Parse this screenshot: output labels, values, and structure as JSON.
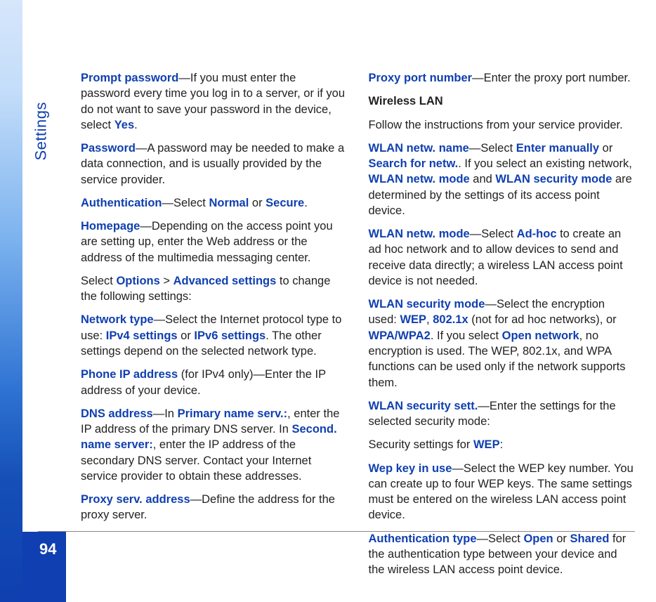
{
  "layout": {
    "section_label": "Settings",
    "page_number": "94"
  },
  "left": {
    "p1_hl_promptpw": "Prompt password",
    "p1_a": "—If you must enter the password every time you log in to a server, or if you do not want to save your password in the device, select ",
    "p1_hl_yes": "Yes",
    "p1_b": ".",
    "p2_hl_password": "Password",
    "p2_a": "—A password may be needed to make a data connection, and is usually provided by the service provider.",
    "p3_hl_auth": "Authentication",
    "p3_a": "—Select ",
    "p3_hl_normal": "Normal",
    "p3_b": " or ",
    "p3_hl_secure": "Secure",
    "p3_c": ".",
    "p4_hl_homepage": "Homepage",
    "p4_a": "—Depending on the access point you are setting up, enter the Web address or the address of the multimedia messaging center.",
    "p5_a": "Select ",
    "p5_hl_options": "Options",
    "p5_b": " > ",
    "p5_hl_advset": "Advanced settings",
    "p5_c": " to change the following settings:",
    "p6_hl_nettype": "Network type",
    "p6_a": "—Select the Internet protocol type to use: ",
    "p6_hl_ipv4": "IPv4 settings",
    "p6_b": " or ",
    "p6_hl_ipv6": "IPv6 settings",
    "p6_c": ". The other settings depend on the selected network type.",
    "p7_hl_phoneip": "Phone IP address",
    "p7_a": " (for IPv4 only)—Enter the IP address of your device.",
    "p8_hl_dnsaddr": "DNS address",
    "p8_a": "—In ",
    "p8_hl_primary": "Primary name serv.:",
    "p8_b": ", enter the IP address of the primary DNS server. In ",
    "p8_hl_second": "Second. name server:",
    "p8_c": ", enter the IP address of the secondary DNS server. Contact your Internet service provider to obtain these addresses.",
    "p9_hl_proxy": "Proxy serv. address",
    "p9_a": "—Define the address for the proxy server."
  },
  "right": {
    "p1_hl_proxyport": "Proxy port number",
    "p1_a": "—Enter the proxy port number.",
    "p2_bold": "Wireless LAN",
    "p3_a": "Follow the instructions from your service provider.",
    "p4_hl_wlanname": "WLAN netw. name",
    "p4_a": "—Select ",
    "p4_hl_enter": "Enter manually",
    "p4_b": " or ",
    "p4_hl_search": "Search for netw.",
    "p4_c": ". If you select an existing network, ",
    "p4_hl_wlanmode": "WLAN netw. mode",
    "p4_d": " and ",
    "p4_hl_wlansec": "WLAN security mode",
    "p4_e": " are determined by the settings of its access point device.",
    "p5_hl_wlanmode": "WLAN netw. mode",
    "p5_a": "—Select ",
    "p5_hl_adhoc": "Ad-hoc",
    "p5_b": " to create an ad hoc network and to allow devices to send and receive data directly; a wireless LAN access point device is not needed.",
    "p6_hl_wlansec": "WLAN security mode",
    "p6_a": "—Select the encryption used: ",
    "p6_hl_wep": "WEP",
    "p6_b": ", ",
    "p6_hl_8021x": "802.1x",
    "p6_c": " (not for ad hoc networks), or ",
    "p6_hl_wpa": "WPA/WPA2",
    "p6_d": ". If you select ",
    "p6_hl_open": "Open network",
    "p6_e": ", no encryption is used. The WEP, 802.1x, and WPA functions can be used only if the network supports them.",
    "p7_hl_wlanset": "WLAN security sett.",
    "p7_a": "—Enter the settings for the selected security mode:",
    "p8_a": "Security settings for ",
    "p8_hl_wep": "WEP",
    "p8_b": ":",
    "p9_hl_wepkey": "Wep key in use",
    "p9_a": "—Select the WEP key number. You can create up to four WEP keys. The same settings must be entered on the wireless LAN access point device.",
    "p10_hl_authtype": "Authentication type",
    "p10_a": "—Select ",
    "p10_hl_openv": "Open",
    "p10_b": " or ",
    "p10_hl_shared": "Shared",
    "p10_c": " for the authentication type between your device and the wireless LAN access point device."
  }
}
